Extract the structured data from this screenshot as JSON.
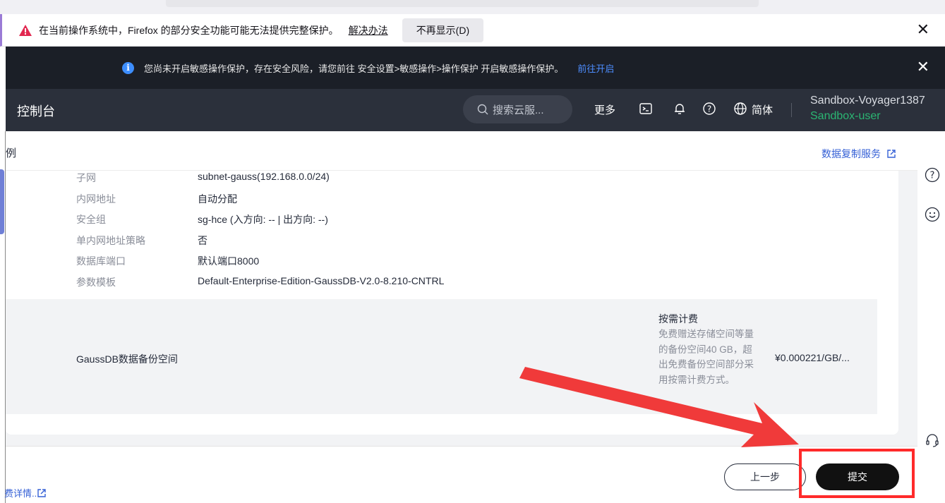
{
  "firefox_bar": {
    "message": "在当前操作系统中，Firefox 的部分安全功能可能无法提供完整保护。",
    "link": "解决办法",
    "dismiss_button": "不再显示(D)",
    "close": "✕"
  },
  "notice": {
    "text": "您尚未开启敏感操作保护，存在安全风险，请您前往 安全设置>敏感操作>操作保护 开启敏感操作保护。",
    "link": "前往开启",
    "close": "✕"
  },
  "header": {
    "title": "控制台",
    "search_placeholder": "搜索云服...",
    "more": "更多",
    "language": "简体",
    "account_name": "Sandbox-Voyager1387",
    "user_name": "Sandbox-user",
    "icons": [
      "terminal-icon",
      "bell-icon",
      "help-icon",
      "globe-icon"
    ]
  },
  "page": {
    "crumb": "例",
    "data_replication_link": "数据复制服务"
  },
  "details": [
    {
      "key": "子网",
      "value": "subnet-gauss(192.168.0.0/24)"
    },
    {
      "key": "内网地址",
      "value": "自动分配"
    },
    {
      "key": "安全组",
      "value": "sg-hce (入方向: -- | 出方向: --)"
    },
    {
      "key": "单内网地址策略",
      "value": "否"
    },
    {
      "key": "数据库端口",
      "value": "默认端口8000"
    },
    {
      "key": "参数模板",
      "value": "Default-Enterprise-Edition-GaussDB-V2.0-8.210-CNTRL"
    }
  ],
  "billing": {
    "name": "GaussDB数据备份空间",
    "mode": "按需计费",
    "description": "免费赠送存储空间等量的备份空间40 GB，超出免费备份空间部分采用按需计费方式。",
    "price": "¥0.000221/GB/..."
  },
  "footer": {
    "fee_detail": "费详情..",
    "prev_button": "上一步",
    "submit_button": "提交"
  },
  "colors": {
    "highlight": "#ff2a2a",
    "arrow": "#f03a3a",
    "link": "#3560d6",
    "user_green": "#2bb673"
  }
}
